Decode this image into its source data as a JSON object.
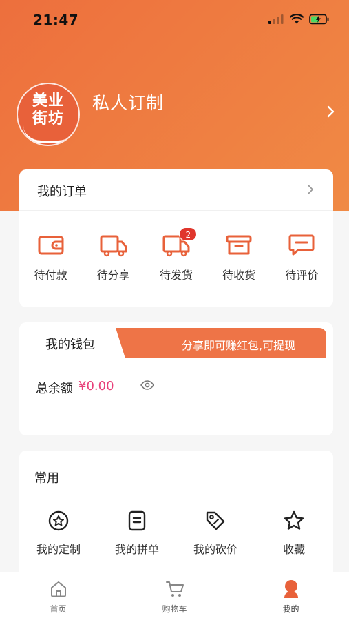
{
  "status_bar": {
    "time": "21:47"
  },
  "profile": {
    "avatar_text_line1": "美业",
    "avatar_text_line2": "街坊",
    "name": "私人订制"
  },
  "orders": {
    "title": "我的订单",
    "items": [
      {
        "label": "待付款",
        "icon": "wallet-icon"
      },
      {
        "label": "待分享",
        "icon": "truck-icon"
      },
      {
        "label": "待发货",
        "icon": "truck-icon",
        "badge": "2"
      },
      {
        "label": "待收货",
        "icon": "box-icon"
      },
      {
        "label": "待评价",
        "icon": "comment-icon"
      }
    ]
  },
  "wallet": {
    "tab_label": "我的钱包",
    "banner_text": "分享即可赚红包,可提现",
    "balance_label": "总余额",
    "balance_value": "¥0.00"
  },
  "common": {
    "title": "常用",
    "items": [
      {
        "label": "我的定制",
        "icon": "custom-icon"
      },
      {
        "label": "我的拼单",
        "icon": "list-icon"
      },
      {
        "label": "我的砍价",
        "icon": "tag-icon"
      },
      {
        "label": "收藏",
        "icon": "star-icon"
      }
    ]
  },
  "tabbar": {
    "items": [
      {
        "label": "首页",
        "icon": "home-icon"
      },
      {
        "label": "购物车",
        "icon": "cart-icon"
      },
      {
        "label": "我的",
        "icon": "user-icon",
        "active": true
      }
    ]
  },
  "colors": {
    "accent": "#ed6f3d",
    "icon_orange": "#e8613a",
    "price_pink": "#e8417a",
    "badge_red": "#e0362c"
  }
}
